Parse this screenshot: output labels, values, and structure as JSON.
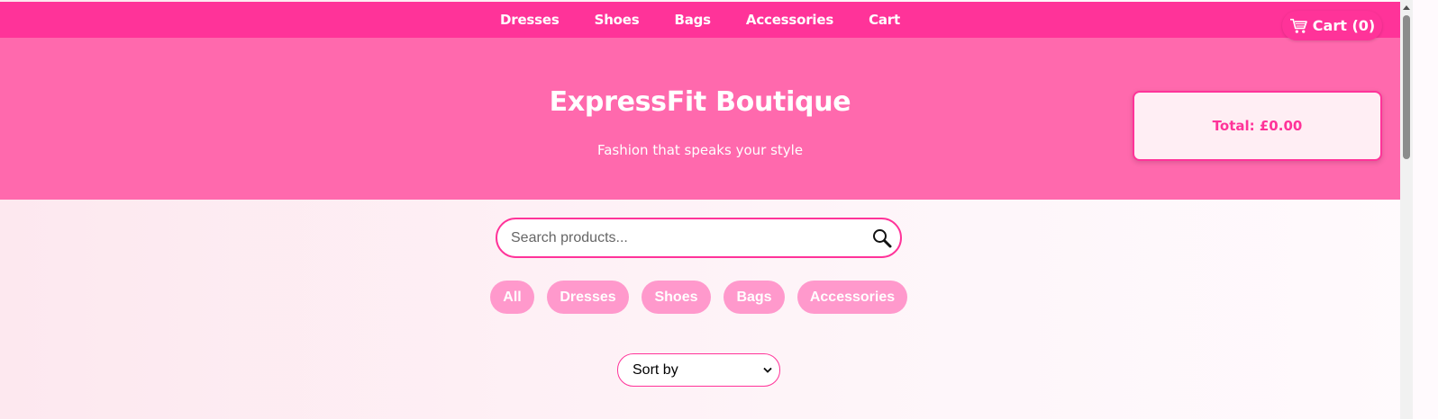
{
  "nav": {
    "items": [
      {
        "label": "Dresses"
      },
      {
        "label": "Shoes"
      },
      {
        "label": "Bags"
      },
      {
        "label": "Accessories"
      },
      {
        "label": "Cart"
      }
    ]
  },
  "cart": {
    "label": "Cart (0)",
    "icon": "cart-icon"
  },
  "hero": {
    "title": "ExpressFit Boutique",
    "subtitle": "Fashion that speaks your style"
  },
  "total": {
    "label": "Total: £0.00"
  },
  "search": {
    "placeholder": "Search products...",
    "icon": "search-icon"
  },
  "filters": {
    "items": [
      {
        "label": "All"
      },
      {
        "label": "Dresses"
      },
      {
        "label": "Shoes"
      },
      {
        "label": "Bags"
      },
      {
        "label": "Accessories"
      }
    ]
  },
  "sort": {
    "selected": "Sort by"
  },
  "colors": {
    "primary": "#ff3399",
    "hero": "#ff69ad",
    "chip": "#ff99cc",
    "panel": "#ffeef4"
  }
}
